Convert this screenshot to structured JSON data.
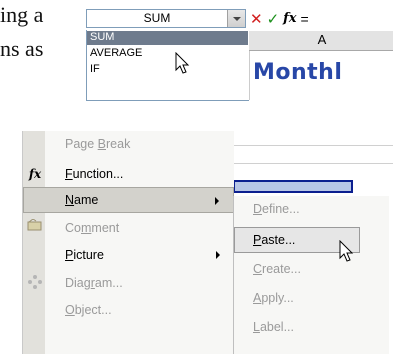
{
  "prose": {
    "line1": "ing a",
    "line2": "ns as"
  },
  "namebox": {
    "value": "SUM"
  },
  "formula_bar": {
    "cancel": "✕",
    "enter": "✓",
    "fx": "fx",
    "equals": "="
  },
  "function_list": [
    "SUM",
    "AVERAGE",
    "IF"
  ],
  "sheet": {
    "column_header": "A",
    "cell_a1": "Monthl"
  },
  "context_menu": {
    "items": [
      {
        "label": "Page Break",
        "enabled": false,
        "icon": ""
      },
      {
        "label": "Function...",
        "enabled": true,
        "icon": "fx-icon"
      },
      {
        "label": "Name",
        "enabled": true,
        "highlighted": true,
        "submenu": true
      },
      {
        "label": "Comment",
        "enabled": false,
        "icon": "comment-icon"
      },
      {
        "label": "Picture",
        "enabled": true,
        "submenu": true
      },
      {
        "label": "Diagram...",
        "enabled": false,
        "icon": "diagram-icon"
      },
      {
        "label": "Object...",
        "enabled": false
      }
    ]
  },
  "name_submenu": {
    "items": [
      {
        "label": "Define...",
        "enabled": false
      },
      {
        "label": "Paste...",
        "enabled": true,
        "highlighted": true
      },
      {
        "label": "Create...",
        "enabled": false
      },
      {
        "label": "Apply...",
        "enabled": false
      },
      {
        "label": "Label...",
        "enabled": false
      }
    ]
  }
}
